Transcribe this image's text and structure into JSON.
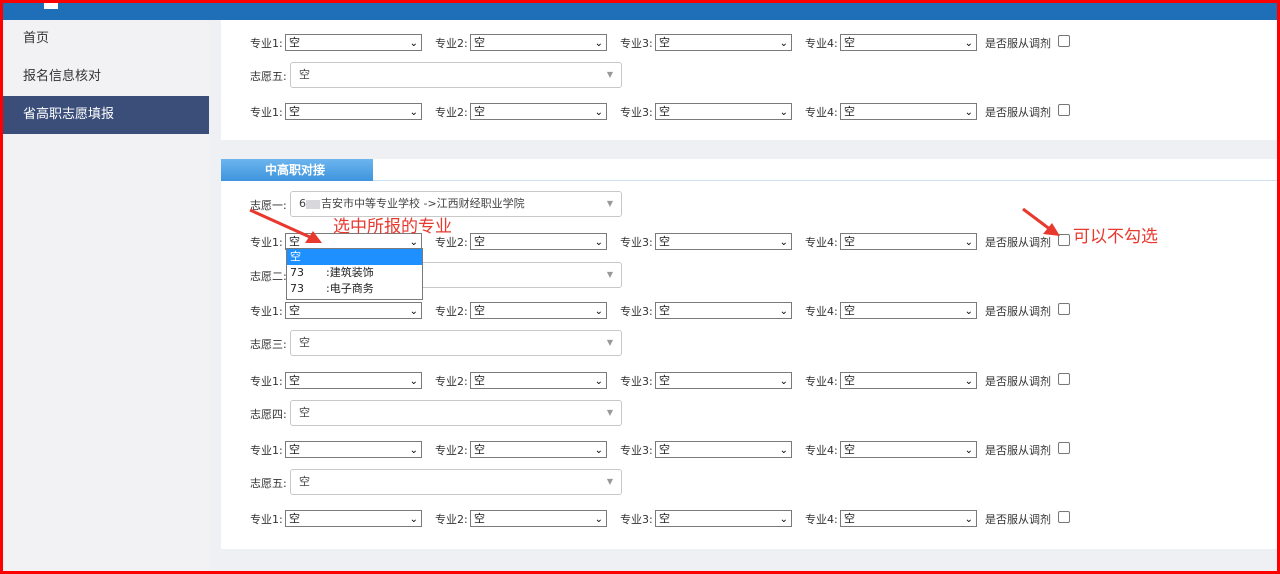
{
  "sidebar": {
    "items": [
      {
        "label": "首页"
      },
      {
        "label": "报名信息核对"
      },
      {
        "label": "省高职志愿填报"
      }
    ]
  },
  "field_labels": {
    "major1": "专业1:",
    "major2": "专业2:",
    "major3": "专业3:",
    "major4": "专业4:",
    "adjust": "是否服从调剂"
  },
  "empty_value": "空",
  "top_section": {
    "choice5_label": "志愿五:"
  },
  "section": {
    "title": "中高职对接",
    "choices": [
      {
        "label": "志愿一:",
        "code_prefix": "6",
        "value": "吉安市中等专业学校 ->江西财经职业学院"
      },
      {
        "label": "志愿二:",
        "value": ""
      },
      {
        "label": "志愿三:",
        "value": "空"
      },
      {
        "label": "志愿四:",
        "value": "空"
      },
      {
        "label": "志愿五:",
        "value": "空"
      }
    ]
  },
  "dropdown": {
    "options": [
      {
        "code": "",
        "name": "空"
      },
      {
        "code": "73",
        "name": ":建筑装饰"
      },
      {
        "code": "73",
        "name": ":电子商务"
      }
    ]
  },
  "annotations": {
    "select_major": "选中所报的专业",
    "optional_check": "可以不勾选"
  },
  "colors": {
    "header_blue": "#1f6fb8",
    "sidebar_active": "#3b4e7a",
    "tab_blue": "#4a9be0",
    "annotation_red": "#e8392f",
    "highlight": "#1e90ff"
  }
}
